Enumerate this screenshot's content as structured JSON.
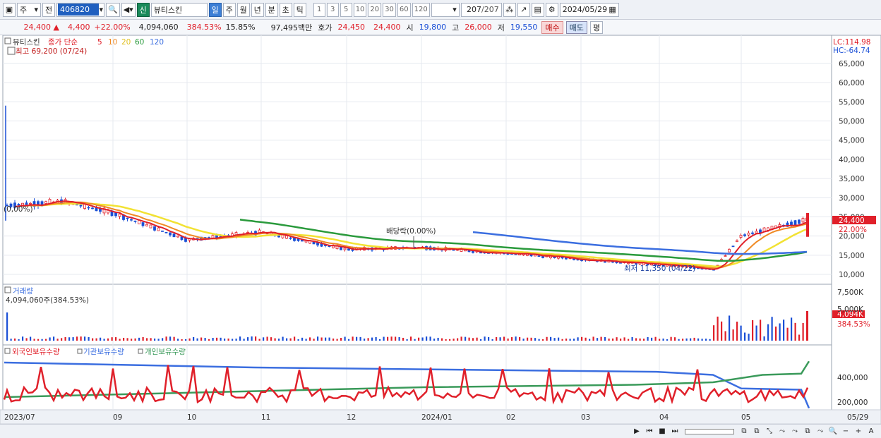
{
  "toolbar": {
    "type_select": "주",
    "prev_label": "전",
    "code": "406820",
    "new_badge": "신",
    "stock_name": "뷰티스킨",
    "periods": [
      "일",
      "주",
      "월",
      "년",
      "분",
      "초",
      "틱"
    ],
    "active_period": "일",
    "nums": [
      "1",
      "3",
      "5",
      "10",
      "20",
      "30",
      "60",
      "120"
    ],
    "count": "207",
    "count_total": "/207",
    "date": "2024/05/29"
  },
  "quote": {
    "price": "24,400",
    "change": "4,400",
    "change_pct": "+22.00%",
    "volume": "4,094,060",
    "vol_ratio": "384.53%",
    "turnover": "15.85%",
    "amount": "97,495백만",
    "bid_label": "호가",
    "bid": "24,450",
    "ask": "24,400",
    "open_label": "시",
    "open": "19,800",
    "high_label": "고",
    "high": "26,000",
    "low_label": "저",
    "low": "19,550",
    "buy_label": "매수",
    "sell_label": "매도",
    "avg_label": "평"
  },
  "price_pane": {
    "legend_name": "뷰티스킨",
    "legend_ma": "종가 단순",
    "ma_periods": [
      "5",
      "10",
      "20",
      "60",
      "120"
    ],
    "max_label": "최고 69,200 (07/24)",
    "min_label": "최저 11,350 (04/22)",
    "event_label": "배당락(0.00%)",
    "left_note": "(0,00%)",
    "lc": "LC:114.98",
    "hc": "HC:-64.74",
    "last_price": "24,400",
    "last_pct": "22.00%",
    "y_ticks": [
      "65,000",
      "60,000",
      "55,000",
      "50,000",
      "45,000",
      "40,000",
      "35,000",
      "30,000",
      "25,000",
      "20,000",
      "15,000",
      "10,000"
    ]
  },
  "volume_pane": {
    "title": "거래량",
    "info": "4,094,060주(384.53%)",
    "y_ticks": [
      "7,500K",
      "5,000K"
    ],
    "last_vol": "4,094K",
    "last_pct": "384.53%"
  },
  "holding_pane": {
    "labels": [
      "외국인보유수량",
      "기관보유수량",
      "개인보유수량"
    ],
    "y_ticks": [
      "400,000",
      "200,000"
    ]
  },
  "x_axis": [
    "2023/07",
    "09",
    "10",
    "11",
    "12",
    "2024/01",
    "02",
    "03",
    "04",
    "05",
    "05/29"
  ],
  "colors": {
    "up": "#e0202a",
    "down": "#1a4fd6",
    "ma5": "#e0202a",
    "ma10": "#f08a24",
    "ma20": "#f2e233",
    "ma60": "#2a9a3c",
    "ma120": "#3b6ee0",
    "foreign": "#e0202a",
    "inst": "#3b6ee0",
    "indiv": "#3a9a5a"
  },
  "chart_data": {
    "type": "candlestick",
    "title": "뷰티스킨",
    "x_range": [
      "2023/07",
      "2024/05/29"
    ],
    "ylim": [
      10000,
      68000
    ],
    "price_keypoints": [
      {
        "date": "2023/07",
        "close": 28000
      },
      {
        "date": "2023/08",
        "close": 29000
      },
      {
        "date": "2023/09",
        "close": 26000
      },
      {
        "date": "2023/10",
        "close": 19000
      },
      {
        "date": "2023/11",
        "close": 21000
      },
      {
        "date": "2023/12",
        "close": 16500
      },
      {
        "date": "2024/01",
        "close": 17000
      },
      {
        "date": "2024/02",
        "close": 15500
      },
      {
        "date": "2024/03",
        "close": 14000
      },
      {
        "date": "2024/04/22",
        "close": 11350
      },
      {
        "date": "2024/05",
        "close": 20000
      },
      {
        "date": "2024/05/29",
        "close": 24400
      }
    ],
    "high": {
      "value": 69200,
      "date": "07/24"
    },
    "low": {
      "value": 11350,
      "date": "04/22"
    }
  }
}
